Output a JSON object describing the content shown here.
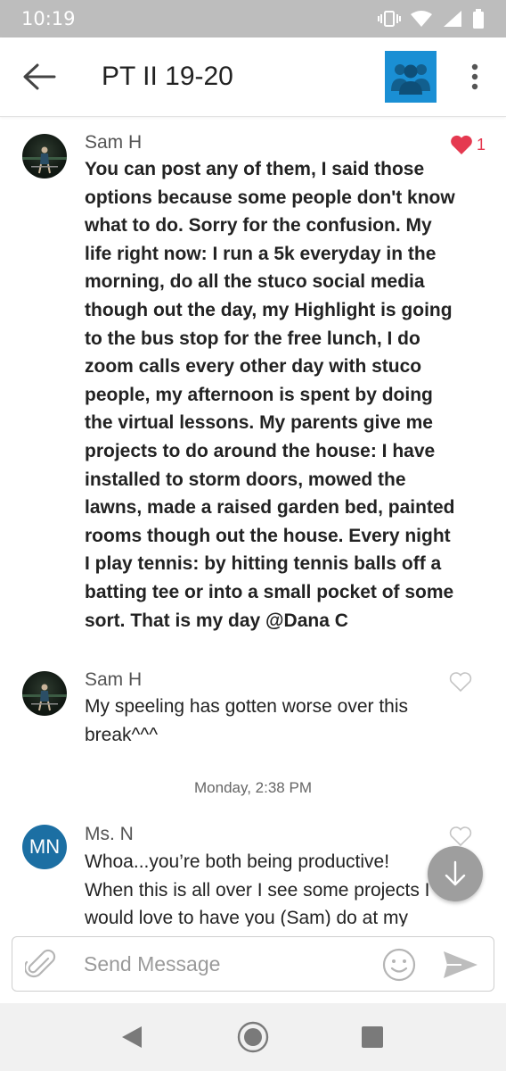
{
  "status_bar": {
    "time": "10:19"
  },
  "header": {
    "title": "PT II 19-20",
    "group_icon": "group-icon",
    "accent": "#1a8fd4"
  },
  "messages": [
    {
      "sender": "Sam H",
      "text": "You can post any of them, I said those options because some people don't know what to do. Sorry for the confusion. My life right now: I run a 5k everyday in the morning, do all the stuco social media though out the day, my Highlight is going to the bus stop for the free lunch, I do zoom calls every other day with stuco people, my afternoon is spent by doing the virtual lessons. My parents give me projects to do around the house: I have installed to storm doors, mowed the lawns, made a raised garden bed, painted rooms though out the house. Every night I play tennis: by hitting tennis balls off a batting tee or into a small pocket of some sort. That is my day @Dana C",
      "likes": "1",
      "liked": true
    },
    {
      "sender": "Sam H",
      "text": "My speeling has gotten worse over this break^^^",
      "liked": false
    },
    {
      "sender": "Ms. N",
      "initials": "MN",
      "text": "Whoa...you’re both being productive! When this is all over I see some projects I would love to have you (Sam) do at my",
      "liked": false
    }
  ],
  "timestamp": "Monday, 2:38 PM",
  "composer": {
    "placeholder": "Send Message"
  },
  "colors": {
    "like_red": "#e53950",
    "avatar_blue": "#1c6fa3"
  }
}
